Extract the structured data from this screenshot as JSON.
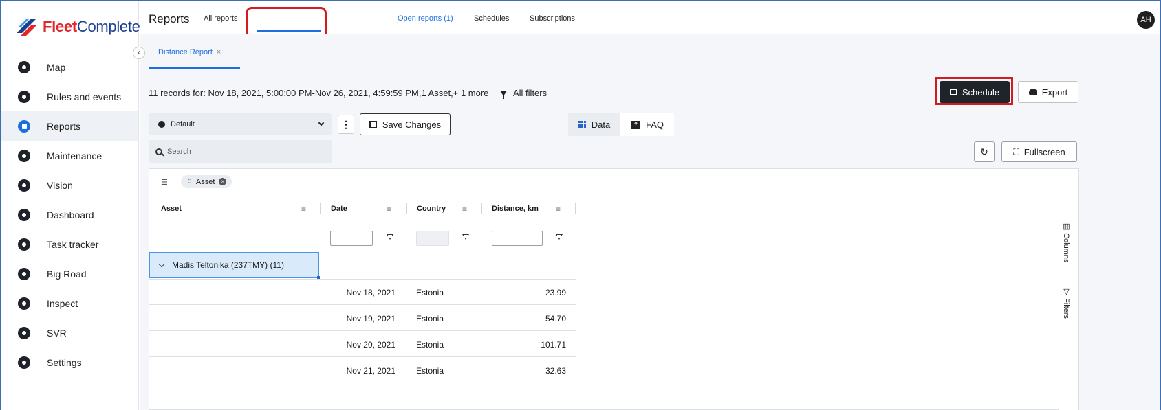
{
  "brand": {
    "logo_text_part1": "Fleet",
    "logo_text_part2": "Complete"
  },
  "sidebar": {
    "items": [
      {
        "label": "Map",
        "icon": "map-pin-icon"
      },
      {
        "label": "Rules and events",
        "icon": "flag-icon"
      },
      {
        "label": "Reports",
        "icon": "report-icon",
        "active": true
      },
      {
        "label": "Maintenance",
        "icon": "wrench-icon"
      },
      {
        "label": "Vision",
        "icon": "camera-icon"
      },
      {
        "label": "Dashboard",
        "icon": "chart-icon"
      },
      {
        "label": "Task tracker",
        "icon": "check-icon"
      },
      {
        "label": "Big Road",
        "icon": "road-icon"
      },
      {
        "label": "Inspect",
        "icon": "clipboard-icon"
      },
      {
        "label": "SVR",
        "icon": "svr-icon"
      },
      {
        "label": "Settings",
        "icon": "gear-icon"
      }
    ]
  },
  "header": {
    "title": "Reports",
    "tabs": [
      {
        "label": "All reports"
      },
      {
        "label": "Open reports (1)",
        "active": true
      },
      {
        "label": "Schedules"
      },
      {
        "label": "Subscriptions"
      }
    ],
    "avatar": "AH"
  },
  "report": {
    "tab_label": "Distance Report",
    "tab_close": "×",
    "records_text": "11 records for:  Nov 18, 2021, 5:00:00 PM-Nov 26, 2021, 4:59:59 PM,1 Asset,+ 1 more",
    "all_filters": "All filters",
    "schedule_label": "Schedule",
    "export_label": "Export",
    "view_selected": "Default",
    "kebab": "⋮",
    "save_label": "Save Changes",
    "toggle_data": "Data",
    "toggle_faq": "FAQ",
    "faq_icon": "?",
    "search_placeholder": "Search",
    "refresh_glyph": "↻",
    "fullscreen_label": "Fullscreen",
    "fullscreen_glyph": "⛶"
  },
  "grid": {
    "group_chip": "Asset",
    "chip_drag": "⠿",
    "chip_close": "×",
    "group_bar_icon": "☰",
    "column_menu": "≡",
    "columns": [
      "Asset",
      "Date",
      "Country",
      "Distance, km"
    ],
    "group_row_label": "Madis Teltonika (237TMY) (11)",
    "rows": [
      {
        "date": "Nov 18, 2021",
        "country": "Estonia",
        "distance": "23.99"
      },
      {
        "date": "Nov 19, 2021",
        "country": "Estonia",
        "distance": "54.70"
      },
      {
        "date": "Nov 20, 2021",
        "country": "Estonia",
        "distance": "101.71"
      },
      {
        "date": "Nov 21, 2021",
        "country": "Estonia",
        "distance": "32.63"
      }
    ],
    "side_columns": "Columns",
    "side_filters": "Filters",
    "side_columns_icon": "▥",
    "side_filters_icon": "▽"
  },
  "colors": {
    "accent": "#1d6fe0",
    "highlight": "#d51b22",
    "dark_button": "#1f232a"
  }
}
